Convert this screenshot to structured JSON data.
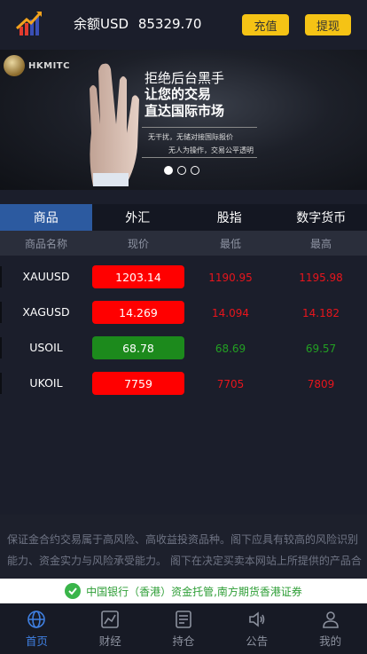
{
  "header": {
    "balance_label": "余额USD",
    "balance_value": "85329.70",
    "recharge_label": "充值",
    "withdraw_label": "提现"
  },
  "banner": {
    "brand": "HKMITC",
    "line1": "拒绝后台黑手",
    "line2": "让您的交易",
    "line3": "直达国际市场",
    "sub1": "无干扰，无储对接国际报价",
    "sub2": "无人为操作，交易公平透明",
    "slides": 3,
    "active_slide": 0
  },
  "tabs": [
    {
      "label": "商品",
      "active": true
    },
    {
      "label": "外汇",
      "active": false
    },
    {
      "label": "股指",
      "active": false
    },
    {
      "label": "数字货币",
      "active": false
    }
  ],
  "columns": {
    "name": "商品名称",
    "price": "现价",
    "low": "最低",
    "high": "最高"
  },
  "rows": [
    {
      "name": "XAUUSD",
      "price": "1203.14",
      "low": "1190.95",
      "high": "1195.98",
      "trend": "down"
    },
    {
      "name": "XAGUSD",
      "price": "14.269",
      "low": "14.094",
      "high": "14.182",
      "trend": "down"
    },
    {
      "name": "USOIL",
      "price": "68.78",
      "low": "68.69",
      "high": "69.57",
      "trend": "up"
    },
    {
      "name": "UKOIL",
      "price": "7759",
      "low": "7705",
      "high": "7809",
      "trend": "down"
    }
  ],
  "colors": {
    "down": "#ff0000",
    "down_text": "#e8151c",
    "up": "#1c8a1c",
    "up_text": "#23a023",
    "accent": "#3f7fe0",
    "button": "#f5c315"
  },
  "notice": "保证金合约交易属于高风险、高收益投资品种。阁下应具有较高的风险识别能力、资金实力与风险承受能力。 阁下在决定买卖本网站上所提供的产品合",
  "bank_notice": "中国银行（香港）资金托管,南方期货香港证券",
  "nav": [
    {
      "label": "首页",
      "icon": "globe-icon",
      "active": true
    },
    {
      "label": "财经",
      "icon": "chart-icon",
      "active": false
    },
    {
      "label": "持仓",
      "icon": "document-icon",
      "active": false
    },
    {
      "label": "公告",
      "icon": "speaker-icon",
      "active": false
    },
    {
      "label": "我的",
      "icon": "user-icon",
      "active": false
    }
  ]
}
